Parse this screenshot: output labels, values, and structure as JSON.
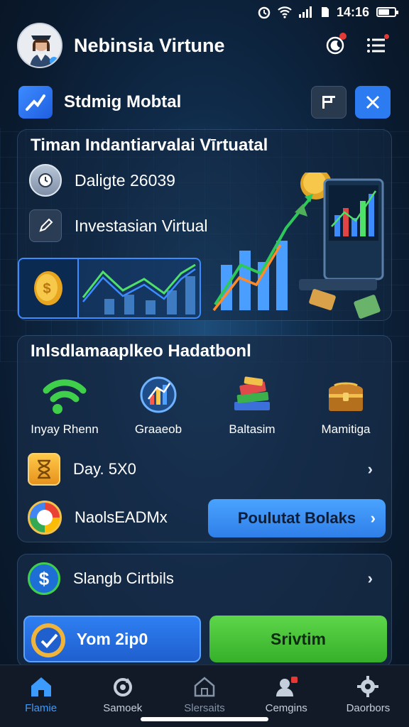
{
  "status": {
    "time": "14:16",
    "battery_level": 0.7
  },
  "header": {
    "title": "Nebinsia Virtune"
  },
  "subheader": {
    "title": "Stdmig Mobtal"
  },
  "card1": {
    "title": "Timan Indantiarvalai Vīrtuatal",
    "row1": {
      "label": "Daligte 26039",
      "icon": "clock-badge-icon"
    },
    "row2": {
      "label": "Investasian Virtual",
      "icon": "pencil-icon"
    }
  },
  "card2": {
    "title": "Inlsdlamaaplkeo Hadatbonl",
    "quick": [
      {
        "label": "Inyay Rhenn",
        "icon": "wifi-icon"
      },
      {
        "label": "Graaeob",
        "icon": "chart-circle-icon"
      },
      {
        "label": "Baltasim",
        "icon": "books-icon"
      },
      {
        "label": "Mamitiga",
        "icon": "treasure-chest-icon"
      }
    ],
    "day_row": {
      "label": "Day. 5X0"
    },
    "google_row": {
      "label": "NaolsEADMx",
      "cta": "Poulutat Bolaks"
    }
  },
  "card3": {
    "row": {
      "label": "Slangb Cirtbils"
    },
    "btn_left": "Yom 2ip0",
    "btn_right": "Srivtim"
  },
  "nav": [
    {
      "label": "Flamie",
      "icon": "home-icon",
      "active": true
    },
    {
      "label": "Samoek",
      "icon": "refresh-icon",
      "active": false
    },
    {
      "label": "Slersaits",
      "icon": "house-outline-icon",
      "active": false
    },
    {
      "label": "Cemgins",
      "icon": "user-badge-icon",
      "active": false
    },
    {
      "label": "Daorbors",
      "icon": "gear-icon",
      "active": false
    }
  ],
  "colors": {
    "accent": "#2d7bf0",
    "green": "#4cc43a",
    "gold": "#f0b43a"
  }
}
